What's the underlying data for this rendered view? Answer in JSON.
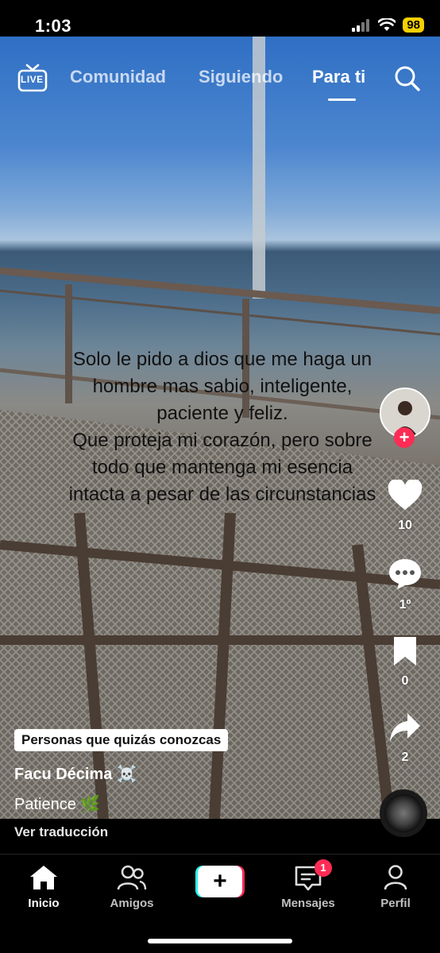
{
  "status_bar": {
    "time": "1:03",
    "battery": "98"
  },
  "top_nav": {
    "live_label": "LIVE",
    "tabs": [
      {
        "label": "Comunidad"
      },
      {
        "label": "Siguiendo"
      },
      {
        "label": "Para ti",
        "active": true
      }
    ],
    "search_icon": "search-icon"
  },
  "video": {
    "caption_lines": [
      "Solo le pido a dios que me haga un",
      "hombre mas sabio, inteligente,",
      "paciente y feliz.",
      "Que proteja mi corazón, pero sobre",
      "todo que mantenga mi esencia",
      "intacta a pesar de las circunstancias"
    ]
  },
  "actions": {
    "likes": "10",
    "comments": "1º",
    "saves": "0",
    "shares": "2"
  },
  "post": {
    "suggestion_chip": "Personas que quizás conozcas",
    "username": "Facu Décima ☠️",
    "description": "Patience 🌿",
    "translate_label": "Ver traducción"
  },
  "bottom_nav": {
    "items": [
      {
        "label": "Inicio",
        "icon": "home-icon",
        "active": true
      },
      {
        "label": "Amigos",
        "icon": "friends-icon"
      },
      {
        "label": "",
        "icon": "create-icon"
      },
      {
        "label": "Mensajes",
        "icon": "inbox-icon",
        "badge": "1"
      },
      {
        "label": "Perfil",
        "icon": "profile-icon"
      }
    ]
  },
  "colors": {
    "accent": "#fe2c55",
    "cyan": "#25f4ee",
    "battery": "#f5d000"
  }
}
